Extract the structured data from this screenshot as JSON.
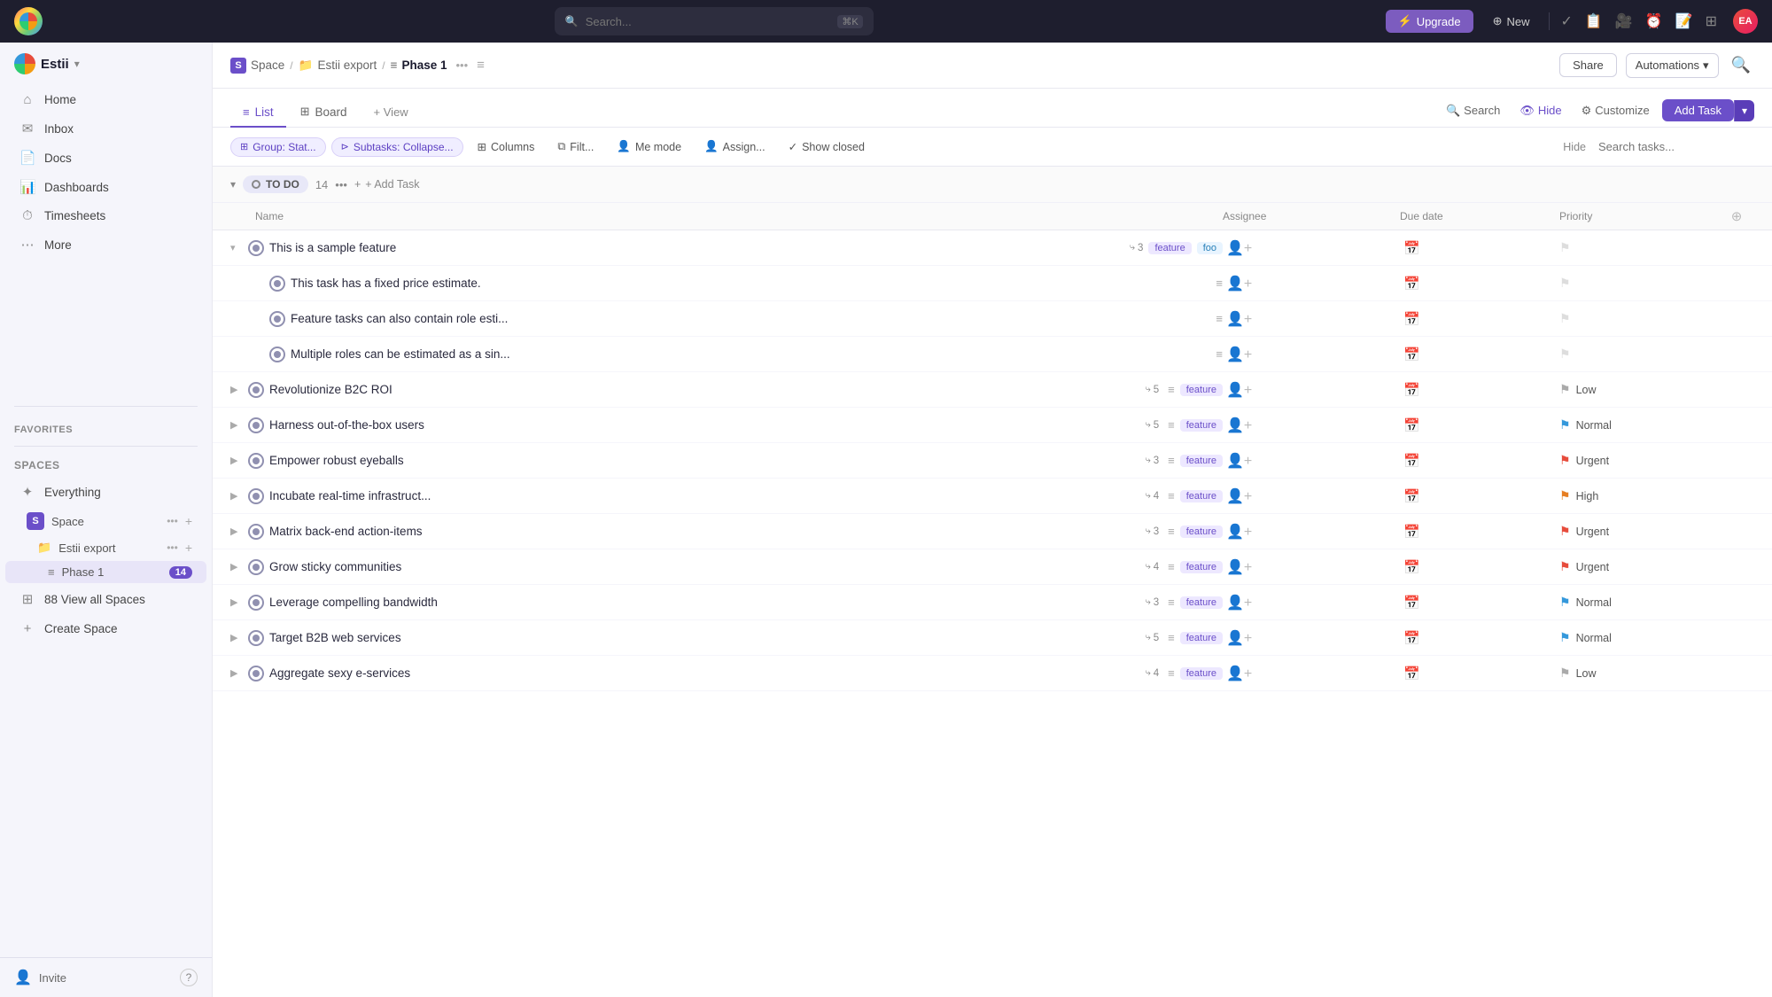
{
  "topbar": {
    "search_placeholder": "Search...",
    "search_shortcut": "⌘K",
    "upgrade_label": "Upgrade",
    "new_label": "New"
  },
  "sidebar": {
    "workspace": "Estii",
    "nav_items": [
      {
        "id": "home",
        "label": "Home",
        "icon": "⌂"
      },
      {
        "id": "inbox",
        "label": "Inbox",
        "icon": "✉"
      },
      {
        "id": "docs",
        "label": "Docs",
        "icon": "📄"
      },
      {
        "id": "dashboards",
        "label": "Dashboards",
        "icon": "📊"
      },
      {
        "id": "timesheets",
        "label": "Timesheets",
        "icon": "⏱"
      },
      {
        "id": "more",
        "label": "More",
        "icon": "⋯"
      }
    ],
    "favorites_label": "Favorites",
    "spaces_label": "Spaces",
    "spaces": [
      {
        "id": "everything",
        "label": "Everything",
        "icon": "✦"
      },
      {
        "id": "space",
        "label": "Space",
        "letter": "S",
        "children": [
          {
            "id": "estii-export",
            "label": "Estii export",
            "icon": "📁",
            "children": [
              {
                "id": "phase1",
                "label": "Phase 1",
                "icon": "≡",
                "badge": "14",
                "active": true
              }
            ]
          }
        ]
      }
    ],
    "view_all_spaces": "88  View all Spaces",
    "create_space": "Create Space",
    "invite_label": "Invite",
    "help_icon": "?"
  },
  "breadcrumb": {
    "space": "Space",
    "export": "Estii export",
    "current": "Phase 1"
  },
  "header_buttons": {
    "share": "Share",
    "automations": "Automations"
  },
  "view_tabs": [
    {
      "id": "list",
      "label": "List",
      "active": true
    },
    {
      "id": "board",
      "label": "Board"
    },
    {
      "id": "add-view",
      "label": "+ View"
    }
  ],
  "toolbar": {
    "search_label": "Search",
    "hide_label": "Hide",
    "customize_label": "Customize",
    "add_task_label": "Add Task"
  },
  "filter_bar": {
    "group_chip": "Group: Stat...",
    "subtasks_chip": "Subtasks: Collapse...",
    "columns_btn": "Columns",
    "filter_btn": "Filt...",
    "me_mode_btn": "Me mode",
    "assign_btn": "Assign...",
    "show_closed_btn": "Show closed",
    "hide_btn": "Hide",
    "search_placeholder": "Search tasks..."
  },
  "task_group": {
    "status": "TO DO",
    "count": "14",
    "add_task_label": "+ Add Task"
  },
  "table_headers": [
    "Name",
    "Assignee",
    "Due date",
    "Priority"
  ],
  "tasks": [
    {
      "id": "1",
      "name": "This is a sample feature",
      "subtasks": "3",
      "tags": [
        "feature",
        "foo"
      ],
      "priority": "none",
      "priority_label": "",
      "expanded": true,
      "indent": 0,
      "children": [
        {
          "id": "1a",
          "name": "This task has a fixed price estimate.",
          "subtasks": null,
          "tags": [],
          "priority": "none",
          "priority_label": "",
          "indent": 1
        },
        {
          "id": "1b",
          "name": "Feature tasks can also contain role esti...",
          "subtasks": null,
          "tags": [],
          "priority": "none",
          "priority_label": "",
          "indent": 1
        },
        {
          "id": "1c",
          "name": "Multiple roles can be estimated as a sin...",
          "subtasks": null,
          "tags": [],
          "priority": "none",
          "priority_label": "",
          "indent": 1
        }
      ]
    },
    {
      "id": "2",
      "name": "Revolutionize B2C ROI",
      "subtasks": "5",
      "tags": [
        "feature"
      ],
      "priority": "low",
      "priority_label": "Low",
      "indent": 0
    },
    {
      "id": "3",
      "name": "Harness out-of-the-box users",
      "subtasks": "5",
      "tags": [
        "feature"
      ],
      "priority": "normal",
      "priority_label": "Normal",
      "indent": 0
    },
    {
      "id": "4",
      "name": "Empower robust eyeballs",
      "subtasks": "3",
      "tags": [
        "feature"
      ],
      "priority": "urgent",
      "priority_label": "Urgent",
      "indent": 0
    },
    {
      "id": "5",
      "name": "Incubate real-time infrastruct...",
      "subtasks": "4",
      "tags": [
        "feature"
      ],
      "priority": "high",
      "priority_label": "High",
      "indent": 0
    },
    {
      "id": "6",
      "name": "Matrix back-end action-items",
      "subtasks": "3",
      "tags": [
        "feature"
      ],
      "priority": "urgent",
      "priority_label": "Urgent",
      "indent": 0
    },
    {
      "id": "7",
      "name": "Grow sticky communities",
      "subtasks": "4",
      "tags": [
        "feature"
      ],
      "priority": "urgent",
      "priority_label": "Urgent",
      "indent": 0
    },
    {
      "id": "8",
      "name": "Leverage compelling bandwidth",
      "subtasks": "3",
      "tags": [
        "feature"
      ],
      "priority": "normal",
      "priority_label": "Normal",
      "indent": 0
    },
    {
      "id": "9",
      "name": "Target B2B web services",
      "subtasks": "5",
      "tags": [
        "feature"
      ],
      "priority": "normal",
      "priority_label": "Normal",
      "indent": 0
    },
    {
      "id": "10",
      "name": "Aggregate sexy e-services",
      "subtasks": "4",
      "tags": [
        "feature"
      ],
      "priority": "low",
      "priority_label": "Low",
      "indent": 0
    }
  ]
}
